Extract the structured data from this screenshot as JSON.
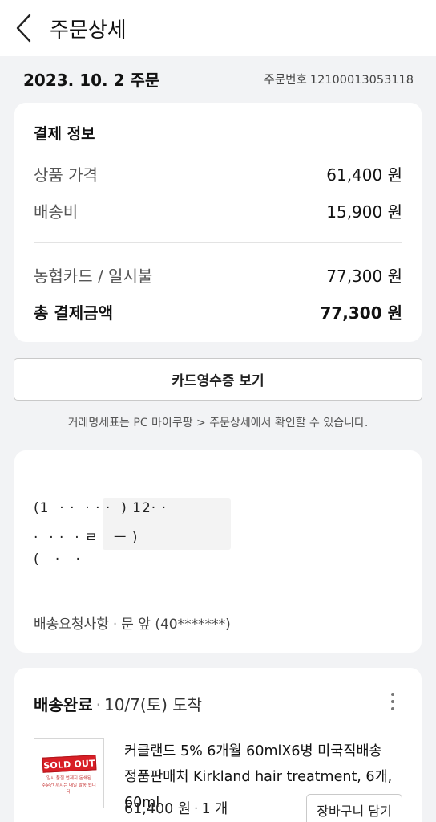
{
  "header": {
    "title": "주문상세"
  },
  "order": {
    "date_label": "2023. 10. 2 주문",
    "number_label": "주문번호",
    "number": "12100013053118"
  },
  "payment": {
    "title": "결제 정보",
    "rows": [
      {
        "label": "상품 가격",
        "value": "61,400 원"
      },
      {
        "label": "배송비",
        "value": "15,900 원"
      },
      {
        "label": "농협카드 / 일시불",
        "value": "77,300 원"
      }
    ],
    "total": {
      "label": "총 결제금액",
      "value": "77,300 원"
    }
  },
  "receipt_button": "카드영수증 보기",
  "notice": "거래명세표는 PC 마이쿠팡 > 주문상세에서 확인할 수 있습니다.",
  "address": {
    "line1": "(1   ‌    ·     ·       ‌ ·  ·  ·   ‌ ) 12·   ·",
    "line2": "·    ‌ · ·      ‌ ·  ㄹ  ‌ ‌ ㅡ )",
    "line3": "(   ‌ ‌ ·      ‌ ‌     ·",
    "request_label": "배송요청사항",
    "request_value": "문 앞 (40*******)"
  },
  "shipment": {
    "status": "배송완료",
    "arrival": "10/7(토) 도착",
    "product": {
      "thumb_badge": "SOLD OUT",
      "thumb_line1": "일시 품절 언제지 돈쇄된",
      "thumb_line2": "주문건 까지는 내일 발송 됩니다.",
      "name": "커클랜드 5% 6개월 60mlX6병 미국직배송 정품판매처 Kirkland hair treatment, 6개, 60ml",
      "price": "61,400 원",
      "qty": "1 개",
      "cart_button": "장바구니 담기"
    }
  }
}
